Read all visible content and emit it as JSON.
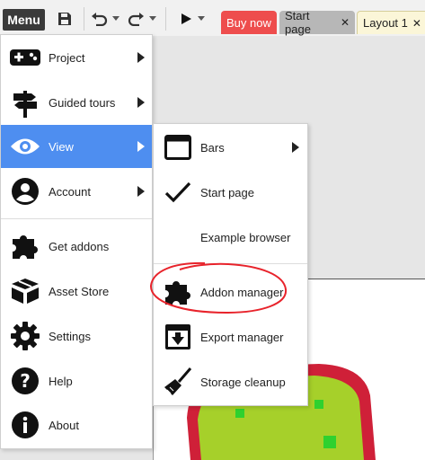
{
  "toolbar": {
    "menu_label": "Menu",
    "icons": [
      "save-icon",
      "undo-icon",
      "redo-icon",
      "play-icon"
    ]
  },
  "tabs": [
    {
      "label": "Buy now",
      "closable": false
    },
    {
      "label": "Start page",
      "closable": true
    },
    {
      "label": "Layout 1",
      "closable": true
    }
  ],
  "main_menu": {
    "items": [
      {
        "label": "Project",
        "icon": "gamepad-icon",
        "submenu": true
      },
      {
        "label": "Guided tours",
        "icon": "signpost-icon",
        "submenu": true
      },
      {
        "label": "View",
        "icon": "eye-icon",
        "submenu": true,
        "active": true
      },
      {
        "label": "Account",
        "icon": "account-icon",
        "submenu": true
      },
      {
        "label": "Get addons",
        "icon": "puzzle-icon",
        "submenu": false
      },
      {
        "label": "Asset Store",
        "icon": "box-icon",
        "submenu": false
      },
      {
        "label": "Settings",
        "icon": "gear-icon",
        "submenu": false
      },
      {
        "label": "Help",
        "icon": "help-icon",
        "submenu": false
      },
      {
        "label": "About",
        "icon": "info-icon",
        "submenu": false
      }
    ]
  },
  "view_submenu": {
    "items": [
      {
        "label": "Bars",
        "icon": "window-icon",
        "submenu": true
      },
      {
        "label": "Start page",
        "icon": "checkmark-icon",
        "checked": true
      },
      {
        "label": "Example browser",
        "icon": "",
        "checked": false
      },
      {
        "label": "Addon manager",
        "icon": "puzzle-icon",
        "highlighted": true
      },
      {
        "label": "Export manager",
        "icon": "export-icon"
      },
      {
        "label": "Storage cleanup",
        "icon": "broom-icon"
      }
    ]
  },
  "colors": {
    "active_item": "#4e8ef0",
    "buy_tab": "#ee4d4d",
    "annotation": "#e8232b",
    "sprite_fill": "#a6d02a",
    "sprite_outline": "#cf2038"
  }
}
